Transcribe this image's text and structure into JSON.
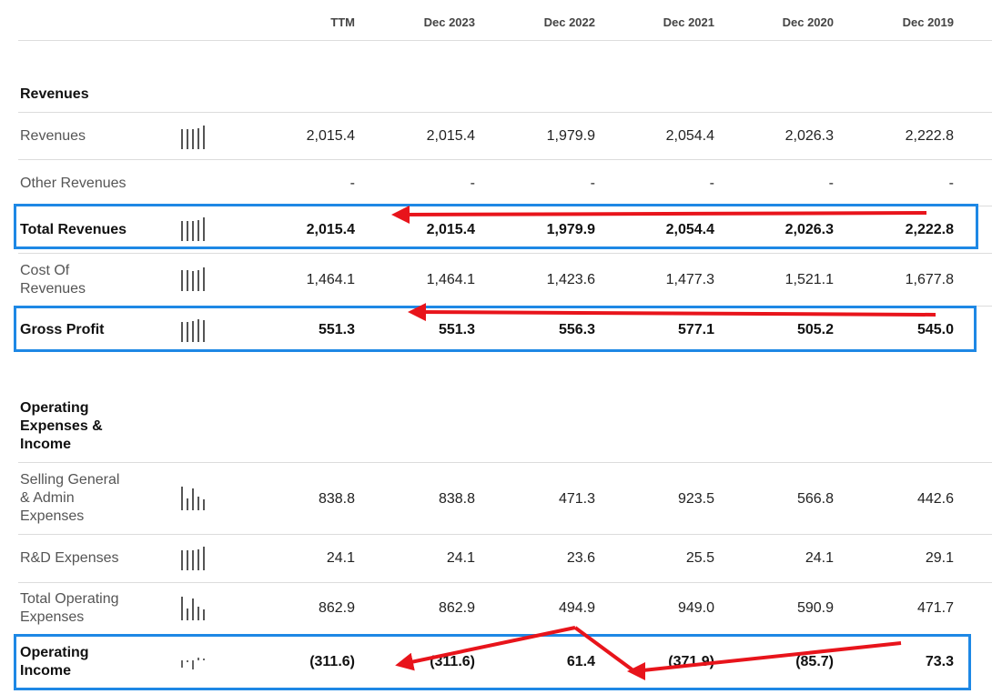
{
  "columns": [
    "TTM",
    "Dec 2023",
    "Dec 2022",
    "Dec 2021",
    "Dec 2020",
    "Dec 2019"
  ],
  "sections": {
    "revenues_title": "Revenues",
    "operating_title_lines": [
      "Operating",
      "Expenses &",
      "Income"
    ]
  },
  "rows": {
    "revenues": {
      "label": [
        "Revenues"
      ],
      "values": [
        "2,015.4",
        "2,015.4",
        "1,979.9",
        "2,054.4",
        "2,026.3",
        "2,222.8"
      ]
    },
    "other_revenues": {
      "label": [
        "Other Revenues"
      ],
      "values": [
        "-",
        "-",
        "-",
        "-",
        "-",
        "-"
      ]
    },
    "total_revenues": {
      "label": [
        "Total Revenues"
      ],
      "values": [
        "2,015.4",
        "2,015.4",
        "1,979.9",
        "2,054.4",
        "2,026.3",
        "2,222.8"
      ]
    },
    "cost_of_revenues": {
      "label": [
        "Cost Of",
        "Revenues"
      ],
      "values": [
        "1,464.1",
        "1,464.1",
        "1,423.6",
        "1,477.3",
        "1,521.1",
        "1,677.8"
      ]
    },
    "gross_profit": {
      "label": [
        "Gross Profit"
      ],
      "values": [
        "551.3",
        "551.3",
        "556.3",
        "577.1",
        "505.2",
        "545.0"
      ]
    },
    "sga": {
      "label": [
        "Selling General",
        "& Admin",
        "Expenses"
      ],
      "values": [
        "838.8",
        "838.8",
        "471.3",
        "923.5",
        "566.8",
        "442.6"
      ]
    },
    "rnd": {
      "label": [
        "R&D Expenses"
      ],
      "values": [
        "24.1",
        "24.1",
        "23.6",
        "25.5",
        "24.1",
        "29.1"
      ]
    },
    "total_opex": {
      "label": [
        "Total Operating",
        "Expenses"
      ],
      "values": [
        "862.9",
        "862.9",
        "494.9",
        "949.0",
        "590.9",
        "471.7"
      ]
    },
    "operating_income": {
      "label": [
        "Operating",
        "Income"
      ],
      "values": [
        "(311.6)",
        "(311.6)",
        "61.4",
        "(371.9)",
        "(85.7)",
        "73.3"
      ]
    }
  },
  "icons": {
    "sparkline": "bar-chart-icon",
    "arrow": "red-arrow-annotation"
  },
  "colors": {
    "highlight": "#1e88e5",
    "arrow": "#e8141b"
  }
}
